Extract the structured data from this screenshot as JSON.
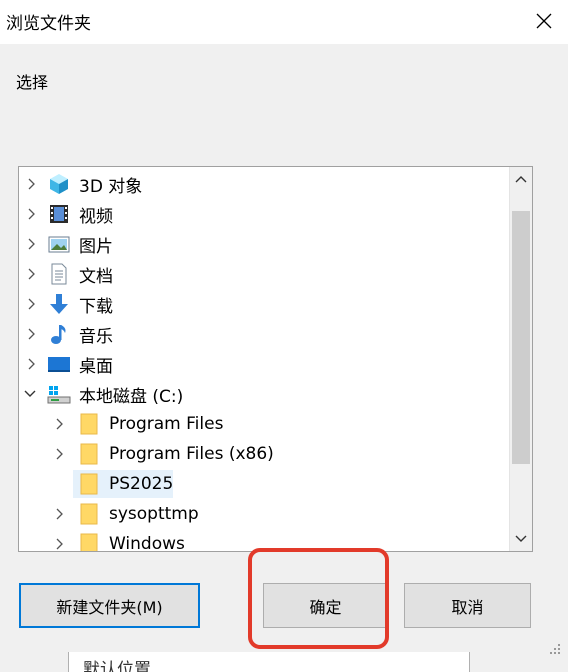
{
  "dialog": {
    "title": "浏览文件夹",
    "close_icon": "close-icon",
    "select_label": "选择"
  },
  "tree": {
    "items": [
      {
        "label": "3D 对象",
        "icon": "3d-objects-icon",
        "expandable": true,
        "level": 0
      },
      {
        "label": "视频",
        "icon": "video-folder-icon",
        "expandable": true,
        "level": 0
      },
      {
        "label": "图片",
        "icon": "pictures-folder-icon",
        "expandable": true,
        "level": 0
      },
      {
        "label": "文档",
        "icon": "documents-folder-icon",
        "expandable": true,
        "level": 0
      },
      {
        "label": "下载",
        "icon": "downloads-folder-icon",
        "expandable": true,
        "level": 0
      },
      {
        "label": "音乐",
        "icon": "music-folder-icon",
        "expandable": true,
        "level": 0
      },
      {
        "label": "桌面",
        "icon": "desktop-folder-icon",
        "expandable": true,
        "level": 0
      },
      {
        "label": "本地磁盘 (C:)",
        "icon": "local-disk-icon",
        "expanded": true,
        "level": 0
      },
      {
        "label": "Program Files",
        "icon": "folder-icon",
        "expandable": true,
        "level": 1
      },
      {
        "label": "Program Files (x86)",
        "icon": "folder-icon",
        "expandable": true,
        "level": 1
      },
      {
        "label": "PS2025",
        "icon": "folder-icon",
        "expandable": false,
        "selected": true,
        "level": 1
      },
      {
        "label": "sysopttmp",
        "icon": "folder-icon",
        "expandable": true,
        "level": 1
      },
      {
        "label": "Windows",
        "icon": "folder-icon",
        "expandable": true,
        "level": 1
      }
    ]
  },
  "buttons": {
    "new_folder": "新建文件夹(M)",
    "ok": "确定",
    "cancel": "取消"
  },
  "background_window": {
    "partial_text": "默认位置"
  },
  "colors": {
    "highlight_box": "#e23a2a",
    "primary_border": "#0078d7",
    "selection": "#e5f1fb",
    "folder_yellow": "#ffd866"
  }
}
